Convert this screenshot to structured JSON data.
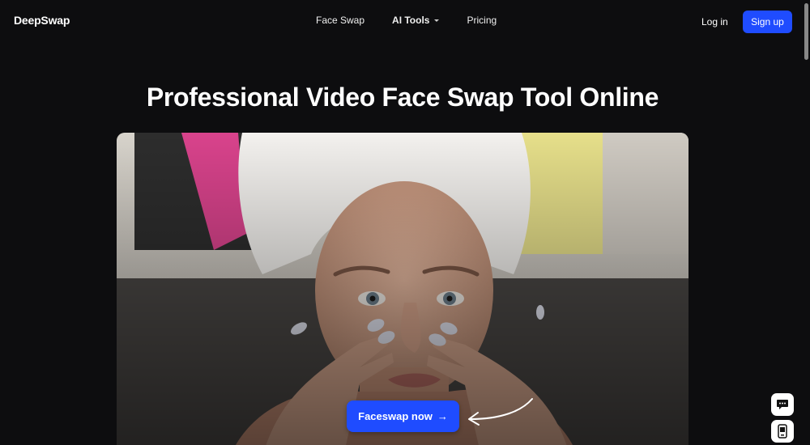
{
  "nav": {
    "logo": "DeepSwap",
    "links": [
      {
        "label": "Face Swap",
        "bold": false
      },
      {
        "label": "AI Tools",
        "bold": true,
        "dropdown": true
      },
      {
        "label": "Pricing",
        "bold": false
      }
    ],
    "login": "Log in",
    "signup": "Sign up"
  },
  "hero": {
    "title": "Professional Video Face Swap Tool Online",
    "cta": "Faceswap now",
    "cta_arrow": "→"
  },
  "widgets": {
    "chat": "chat-bubble-icon",
    "app": "mobile-app-icon"
  },
  "colors": {
    "background": "#0d0d0f",
    "accent": "#1f4cff"
  }
}
